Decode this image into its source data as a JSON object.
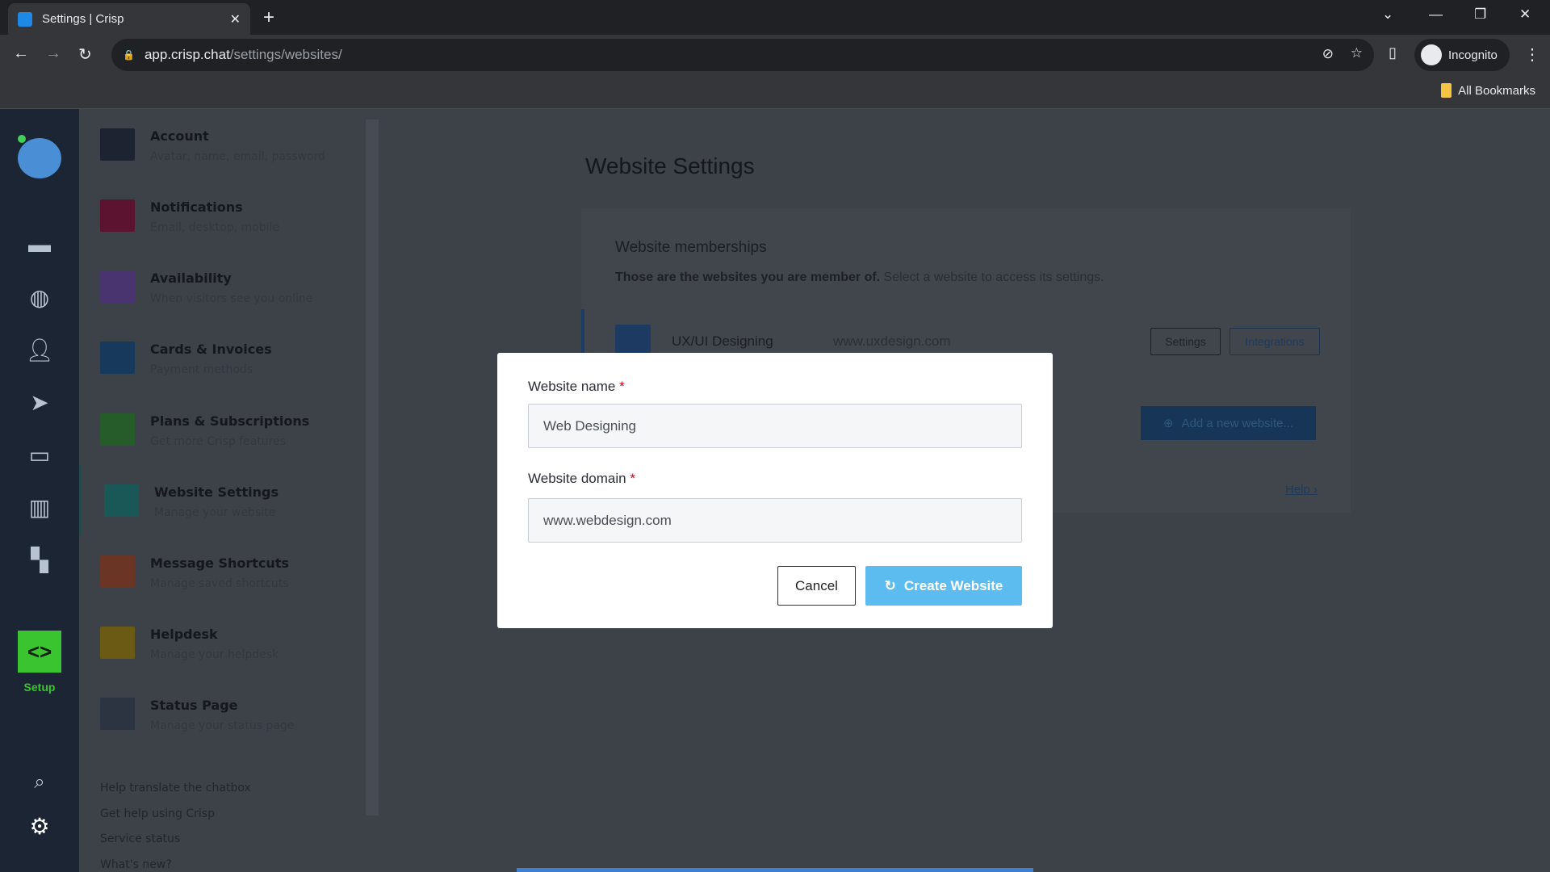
{
  "browser": {
    "tab_title": "Settings | Crisp",
    "url_host": "app.crisp.chat",
    "url_path": "/settings/websites/",
    "profile": "Incognito",
    "bookmarks": "All Bookmarks"
  },
  "rail": {
    "setup_label": "Setup"
  },
  "sidebar": {
    "items": [
      {
        "title": "Account",
        "subtitle": "Avatar, name, email, password",
        "color": "#1d2330"
      },
      {
        "title": "Notifications",
        "subtitle": "Email, desktop, mobile",
        "color": "#5c1330"
      },
      {
        "title": "Availability",
        "subtitle": "When visitors see you online",
        "color": "#4a3470"
      },
      {
        "title": "Cards & Invoices",
        "subtitle": "Payment methods",
        "color": "#173a5c"
      },
      {
        "title": "Plans & Subscriptions",
        "subtitle": "Get more Crisp features",
        "color": "#265c2a"
      },
      {
        "title": "Website Settings",
        "subtitle": "Manage your website",
        "color": "#1a5858"
      },
      {
        "title": "Message Shortcuts",
        "subtitle": "Manage saved shortcuts",
        "color": "#6a3525"
      },
      {
        "title": "Helpdesk",
        "subtitle": "Manage your helpdesk",
        "color": "#6b5a14"
      },
      {
        "title": "Status Page",
        "subtitle": "Manage your status page",
        "color": "#2c3442"
      }
    ],
    "links": [
      "Help translate the chatbox",
      "Get help using Crisp",
      "Service status",
      "What's new?"
    ]
  },
  "main": {
    "title": "Website Settings",
    "section_title": "Website memberships",
    "desc_bold": "Those are the websites you are member of.",
    "desc": " Select a website to access its settings.",
    "website": {
      "name": "UX/UI Designing",
      "domain": "www.uxdesign.com"
    },
    "settings_btn": "Settings",
    "integrations_btn": "Integrations",
    "add_btn": "Add a new website...",
    "help": "Help ›"
  },
  "dialog": {
    "name_label": "Website name",
    "name_value": "Web Designing",
    "domain_label": "Website domain",
    "domain_value": "www.webdesign.com",
    "required": "*",
    "cancel": "Cancel",
    "create": "Create Website"
  }
}
